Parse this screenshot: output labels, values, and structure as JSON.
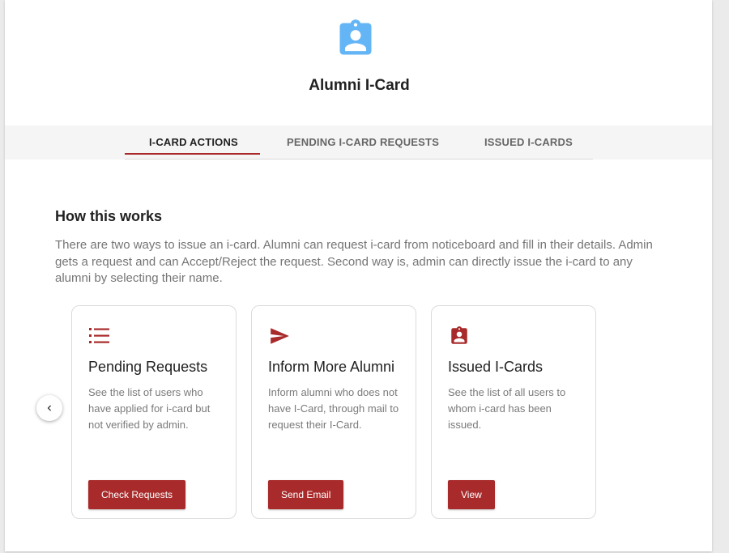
{
  "header": {
    "title": "Alumni I-Card",
    "icon": "id-badge-icon",
    "icon_color": "#64b5f6"
  },
  "tabs": [
    {
      "label": "I-CARD ACTIONS",
      "active": true
    },
    {
      "label": "PENDING I-CARD REQUESTS",
      "active": false
    },
    {
      "label": "ISSUED I-CARDS",
      "active": false
    }
  ],
  "how_it_works": {
    "title": "How this works",
    "body": "There are two ways to issue an i-card. Alumni can request i-card from noticeboard and fill in their details. Admin gets a request and can Accept/Reject the request. Second way is, admin can directly issue the i-card to any alumni by selecting their name."
  },
  "carousel": {
    "prev_icon": "chevron-left-icon"
  },
  "cards": [
    {
      "icon": "list-icon",
      "title": "Pending Requests",
      "description": "See the list of users who have applied for i-card but not verified by admin.",
      "button": "Check Requests"
    },
    {
      "icon": "send-icon",
      "title": "Inform More Alumni",
      "description": "Inform alumni who does not have I-Card, through mail to request their I-Card.",
      "button": "Send Email"
    },
    {
      "icon": "id-badge-icon",
      "title": "Issued I-Cards",
      "description": "See the list of all users to whom i-card has been issued.",
      "button": "View"
    }
  ],
  "colors": {
    "accent": "#a82a2a",
    "header_icon": "#64b5f6",
    "page_bg": "#ebebeb"
  }
}
